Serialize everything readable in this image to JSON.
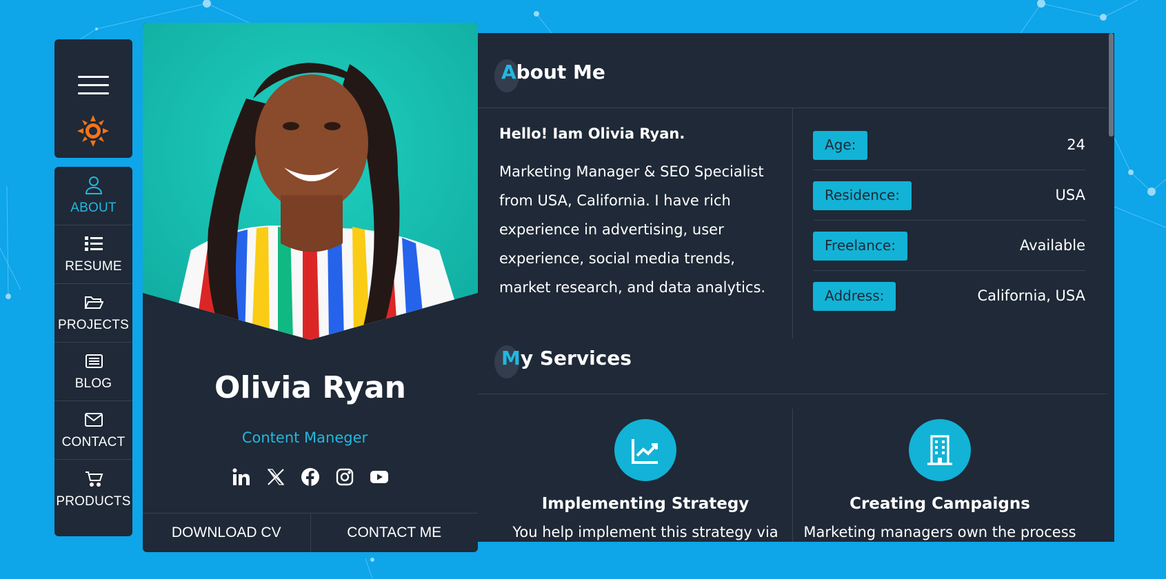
{
  "nav": {
    "items": [
      {
        "label": "ABOUT",
        "icon": "user-icon",
        "active": true
      },
      {
        "label": "RESUME",
        "icon": "list-icon",
        "active": false
      },
      {
        "label": "PROJECTS",
        "icon": "folder-open-icon",
        "active": false
      },
      {
        "label": "BLOG",
        "icon": "newspaper-icon",
        "active": false
      },
      {
        "label": "CONTACT",
        "icon": "envelope-icon",
        "active": false
      },
      {
        "label": "PRODUCTS",
        "icon": "cart-icon",
        "active": false
      }
    ]
  },
  "profile": {
    "name": "Olivia Ryan",
    "role": "Content Maneger",
    "download_cv": "DOWNLOAD CV",
    "contact_me": "CONTACT ME",
    "socials": [
      "linkedin-icon",
      "x-icon",
      "facebook-icon",
      "instagram-icon",
      "youtube-icon"
    ]
  },
  "about": {
    "title_first": "A",
    "title_rest": "bout Me",
    "hello": "Hello! Iam Olivia Ryan.",
    "bio": "Marketing Manager & SEO Specialist from USA, California. I have rich experience in advertising, user experience, social media trends, market research, and data analytics.",
    "info": [
      {
        "label": "Age:",
        "value": "24"
      },
      {
        "label": "Residence:",
        "value": "USA"
      },
      {
        "label": "Freelance:",
        "value": "Available"
      },
      {
        "label": "Address:",
        "value": "California, USA"
      }
    ]
  },
  "services": {
    "title_first": "M",
    "title_rest": "y Services",
    "items": [
      {
        "title": "Implementing Strategy",
        "icon": "chart-up-icon",
        "text": "You help implement this strategy via"
      },
      {
        "title": "Creating Campaigns",
        "icon": "building-icon",
        "text": "Marketing managers own the process"
      }
    ]
  },
  "colors": {
    "background": "#0ea5e9",
    "panel": "#1f2937",
    "accent": "#22b8e0",
    "sun": "#f97316"
  }
}
